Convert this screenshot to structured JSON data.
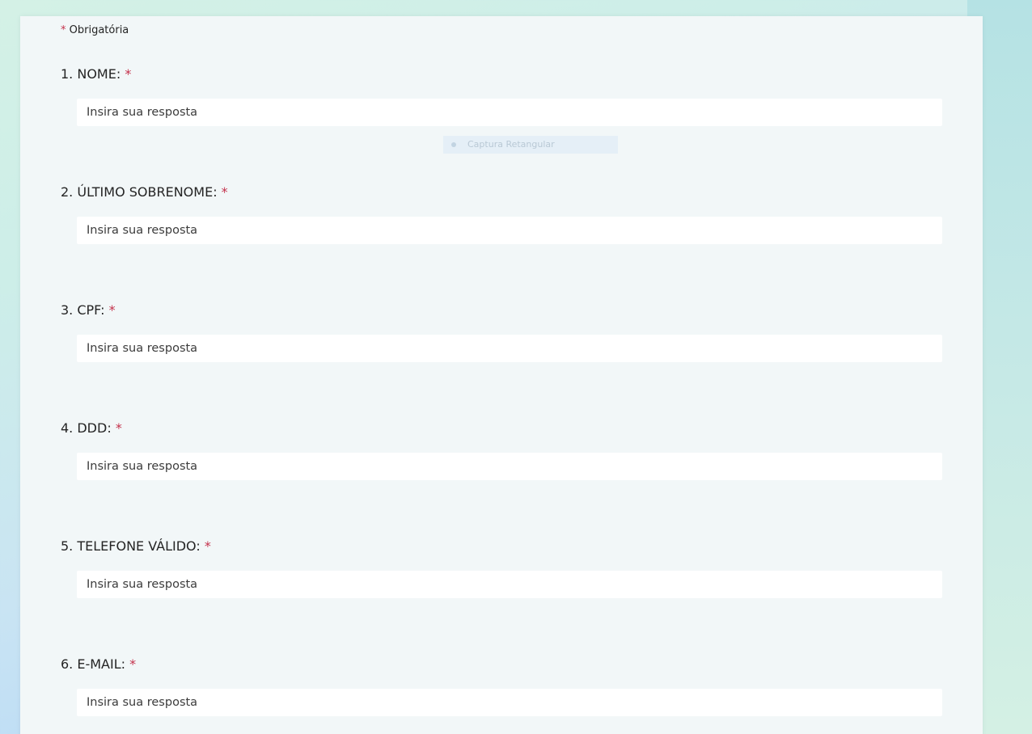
{
  "form": {
    "required_star": "*",
    "required_note": "Obrigatória",
    "questions": [
      {
        "number": "1.",
        "label": "NOME:",
        "placeholder": "Insira sua resposta"
      },
      {
        "number": "2.",
        "label": "ÚLTIMO SOBRENOME:",
        "placeholder": "Insira sua resposta"
      },
      {
        "number": "3.",
        "label": "CPF:",
        "placeholder": "Insira sua resposta"
      },
      {
        "number": "4.",
        "label": "DDD:",
        "placeholder": "Insira sua resposta"
      },
      {
        "number": "5.",
        "label": "TELEFONE VÁLIDO:",
        "placeholder": "Insira sua resposta"
      },
      {
        "number": "6.",
        "label": "E-MAIL:",
        "placeholder": "Insira sua resposta"
      }
    ]
  },
  "overlay": {
    "label": "Captura Retangular"
  },
  "colors": {
    "required_star": "#c4314b",
    "card_background": "#f2f7f8",
    "input_background": "#ffffff",
    "text": "#242424"
  }
}
